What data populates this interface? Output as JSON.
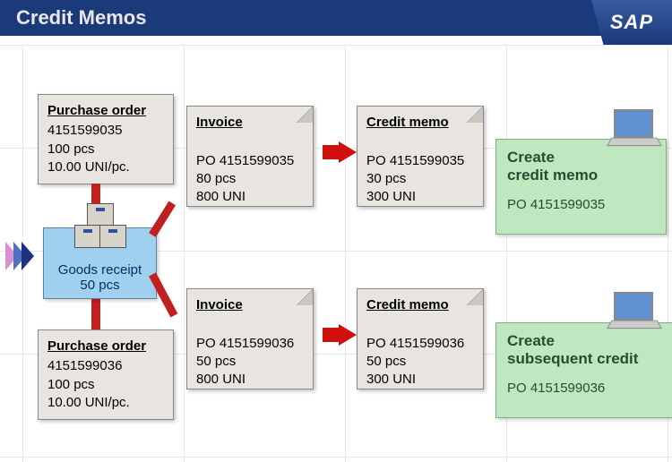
{
  "header": {
    "title": "Credit Memos",
    "logo": "SAP"
  },
  "po1": {
    "title": "Purchase order",
    "number": "4151599035",
    "qty": "100 pcs",
    "price": "10.00 UNI/pc."
  },
  "po2": {
    "title": "Purchase order",
    "number": "4151599036",
    "qty": "100 pcs",
    "price": "10.00 UNI/pc."
  },
  "goods_receipt": {
    "label": "Goods receipt",
    "qty": "50 pcs"
  },
  "inv1": {
    "title": "Invoice",
    "po": "PO 4151599035",
    "qty": "80 pcs",
    "amount": "800 UNI"
  },
  "inv2": {
    "title": "Invoice",
    "po": "PO 4151599036",
    "qty": "50 pcs",
    "amount": "800 UNI"
  },
  "cm1": {
    "title": "Credit memo",
    "po": "PO 4151599035",
    "qty": "30 pcs",
    "amount": "300 UNI"
  },
  "cm2": {
    "title": "Credit memo",
    "po": "PO 4151599036",
    "qty": "50 pcs",
    "amount": "300 UNI"
  },
  "action1": {
    "line1": "Create",
    "line2": "credit memo",
    "po": "PO 4151599035"
  },
  "action2": {
    "line1": "Create",
    "line2": "subsequent credit",
    "po": "PO 4151599036"
  }
}
